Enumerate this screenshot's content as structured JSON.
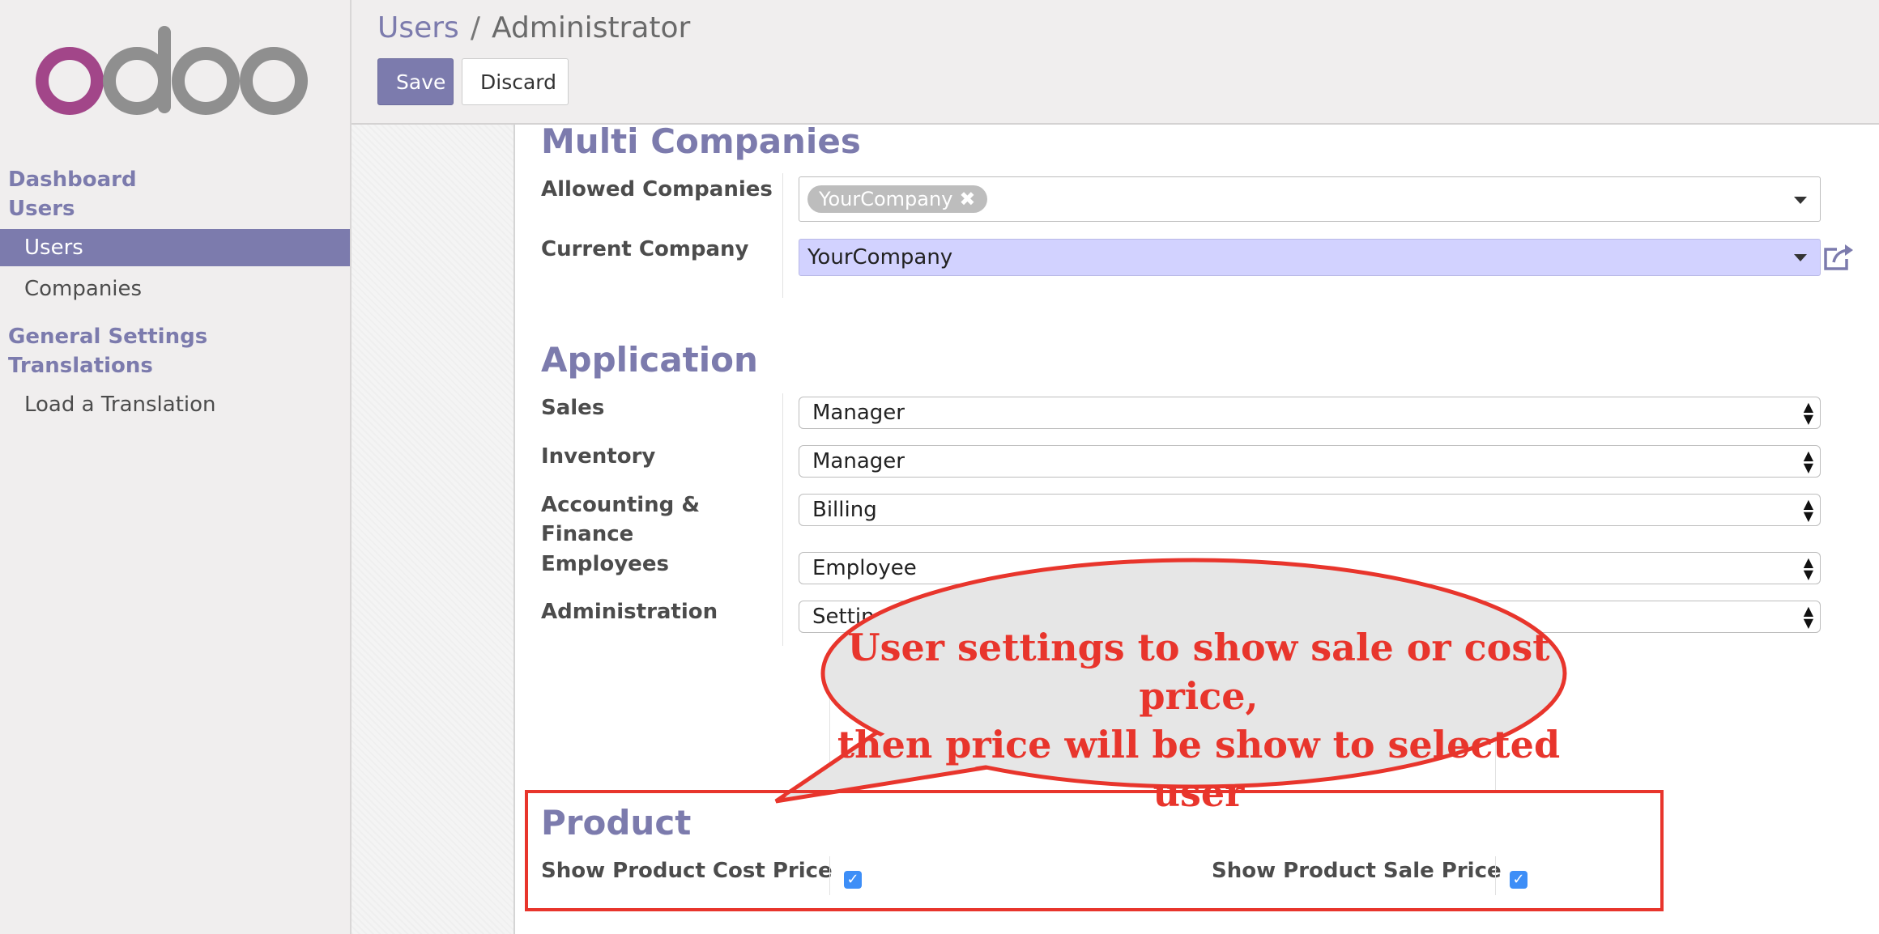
{
  "app": {
    "logo_text": "odoo"
  },
  "sidebar": {
    "sections": [
      {
        "header": "Dashboard"
      },
      {
        "header": "Users",
        "items": [
          {
            "label": "Users",
            "active": true
          },
          {
            "label": "Companies",
            "active": false
          }
        ]
      },
      {
        "header": "General Settings"
      },
      {
        "header": "Translations",
        "items": [
          {
            "label": "Load a Translation",
            "active": false
          }
        ]
      }
    ]
  },
  "breadcrumb": {
    "parent": "Users",
    "separator": "/",
    "current": "Administrator"
  },
  "toolbar": {
    "save_label": "Save",
    "discard_label": "Discard"
  },
  "multi_companies": {
    "title": "Multi Companies",
    "allowed_label": "Allowed Companies",
    "allowed_tags": [
      "YourCompany"
    ],
    "current_label": "Current Company",
    "current_value": "YourCompany"
  },
  "application": {
    "title": "Application",
    "fields": [
      {
        "label": "Sales",
        "value": "Manager"
      },
      {
        "label": "Inventory",
        "value": "Manager"
      },
      {
        "label": "Accounting & Finance",
        "value": "Billing"
      },
      {
        "label": "Employees",
        "value": "Employee"
      },
      {
        "label": "Administration",
        "value": "Settings"
      }
    ]
  },
  "product": {
    "title": "Product",
    "cost_label": "Show Product Cost Price",
    "cost_checked": true,
    "sale_label": "Show Product Sale Price",
    "sale_checked": true
  },
  "annotation": {
    "line1": "User settings to show sale or cost price,",
    "line2": "then price will be show to selected user",
    "color": "#e8352c"
  },
  "colors": {
    "accent": "#7c7bad",
    "m2o_highlight": "#d2d2ff",
    "checkbox": "#3d8ef7"
  }
}
